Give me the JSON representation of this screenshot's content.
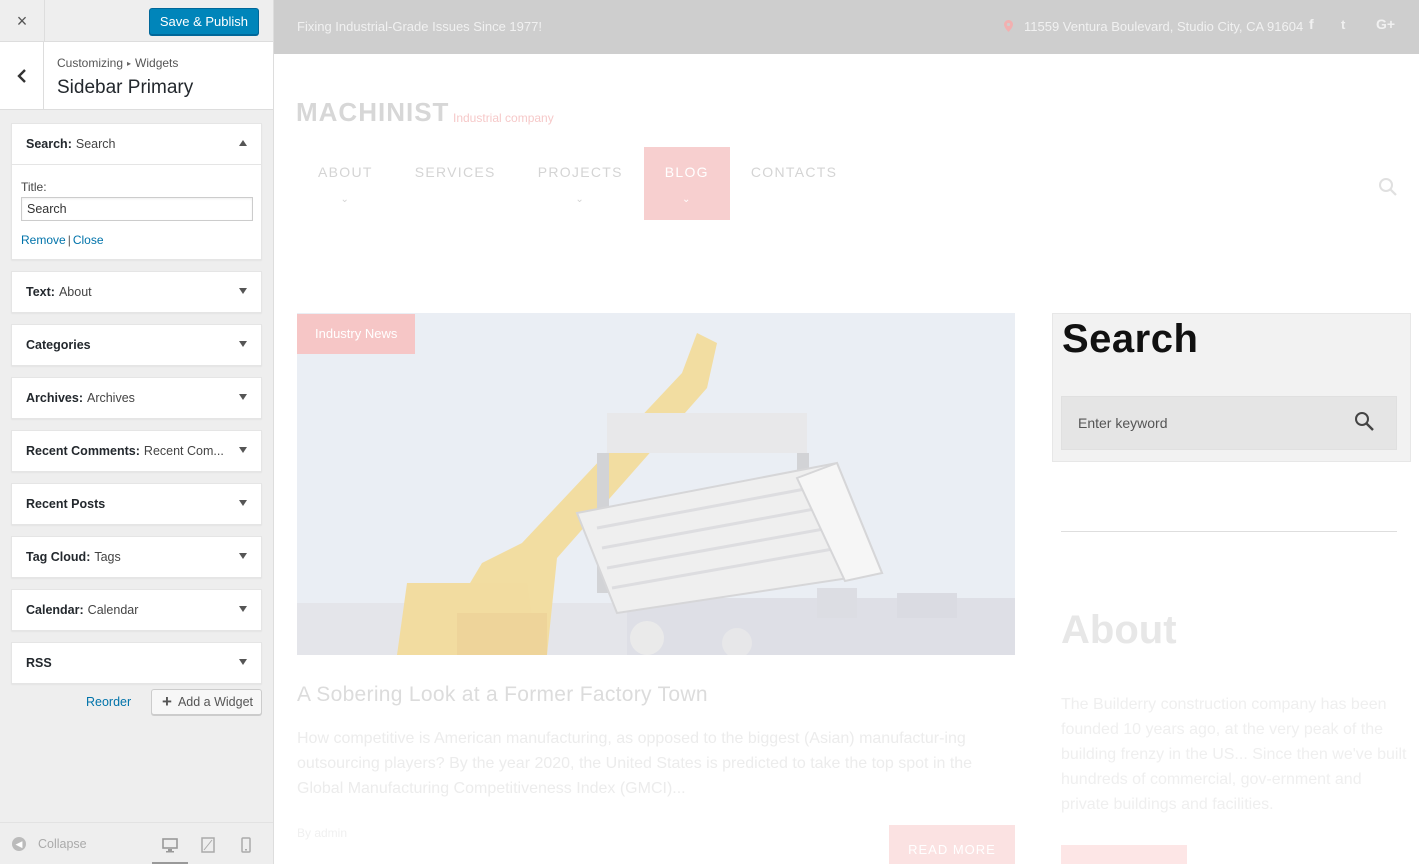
{
  "customizer": {
    "close_label": "×",
    "save_button": "Save & Publish",
    "breadcrumb": [
      "Customizing",
      "Widgets"
    ],
    "section_title": "Sidebar Primary",
    "widgets": [
      {
        "type": "Search",
        "title": "Search",
        "expanded": true
      },
      {
        "type": "Text",
        "title": "About"
      },
      {
        "type": "Categories",
        "title": ""
      },
      {
        "type": "Archives",
        "title": "Archives"
      },
      {
        "type": "Recent Comments",
        "title": "Recent Com..."
      },
      {
        "type": "Recent Posts",
        "title": ""
      },
      {
        "type": "Tag Cloud",
        "title": "Tags"
      },
      {
        "type": "Calendar",
        "title": "Calendar"
      },
      {
        "type": "RSS",
        "title": ""
      }
    ],
    "search_form": {
      "title_label": "Title:",
      "title_value": "Search",
      "remove_link": "Remove",
      "close_link": "Close"
    },
    "reorder_link": "Reorder",
    "add_widget_button": "Add a Widget",
    "collapse_label": "Collapse",
    "devices": [
      "desktop-icon",
      "tablet-icon",
      "mobile-icon"
    ],
    "active_device": "desktop"
  },
  "preview": {
    "tagline": "Fixing Industrial-Grade Issues Since 1977!",
    "address": "11559 Ventura Boulevard, Studio City, CA 91604",
    "social": [
      "f",
      "t",
      "G+"
    ],
    "logo": "MACHINIST",
    "logo_sub": "Industrial company",
    "nav": [
      {
        "label": "ABOUT",
        "has_dropdown": true
      },
      {
        "label": "SERVICES",
        "has_dropdown": false
      },
      {
        "label": "PROJECTS",
        "has_dropdown": true
      },
      {
        "label": "BLOG",
        "has_dropdown": true,
        "active": true
      },
      {
        "label": "CONTACTS",
        "has_dropdown": false
      }
    ],
    "post": {
      "category": "Industry News",
      "title": "A Sobering Look at a Former Factory Town",
      "excerpt": "How competitive is American manufacturing, as opposed to the biggest (Asian) manufactur-ing outsourcing players? By the year 2020, the United States is predicted to take the top spot in the Global Manufacturing Competitiveness Index (GMCI)...",
      "meta": "By admin",
      "read_more": "READ MORE"
    },
    "search_widget": {
      "heading": "Search",
      "placeholder": "Enter keyword"
    },
    "about_widget": {
      "heading": "About",
      "text": "The Builderry construction company has been founded 10 years ago, at the very peak of the building frenzy in the US... Since then we've built hundreds of commercial, gov-ernment and private buildings and facilities."
    }
  }
}
